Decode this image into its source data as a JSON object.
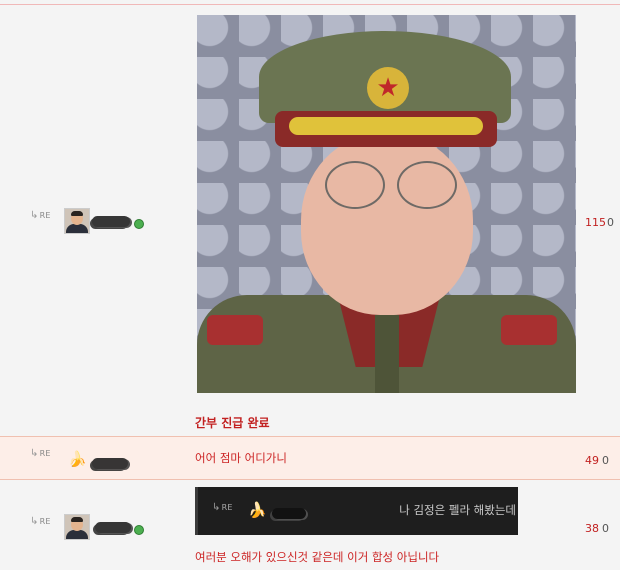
{
  "comments": [
    {
      "re_label": "RE",
      "avatar_icon": "person-avatar-icon",
      "online": true,
      "caption": "간부 진급 완료",
      "count_red": "115",
      "count_gray": "0"
    },
    {
      "re_label": "RE",
      "avatar_icon": "banana-icon",
      "online": false,
      "text": "어어 점마 어디가니",
      "count_red": "49",
      "count_gray": "0"
    },
    {
      "re_label": "RE",
      "avatar_icon": "person-avatar-icon",
      "online": true,
      "quote": {
        "re_label": "RE",
        "avatar_icon": "banana-icon",
        "text": "나 김정은 펠라 해봤는데"
      },
      "text": "여러분 오해가 있으신것 같은데 이거 합성 아닙니다",
      "count_red": "38",
      "count_gray": "0"
    }
  ],
  "colors": {
    "accent_red": "#c22121",
    "highlight_row": "#fdeee8",
    "online_green": "#4caf50"
  }
}
